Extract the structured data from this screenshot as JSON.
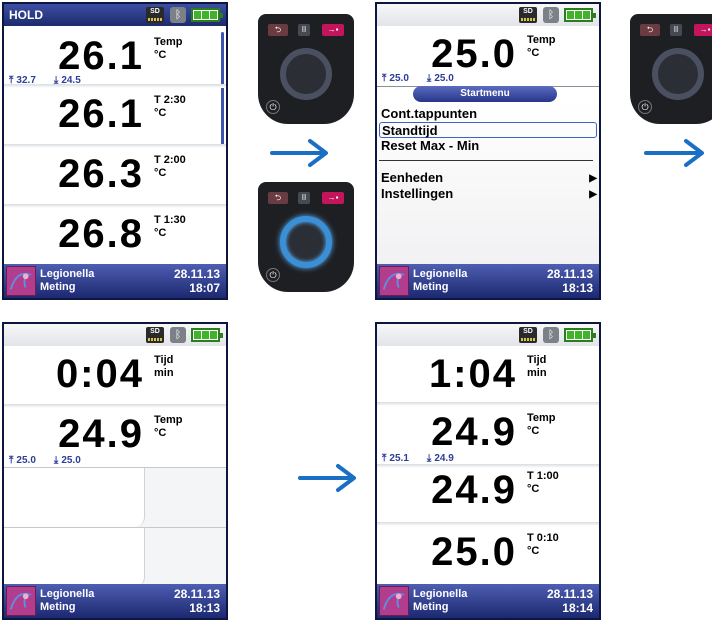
{
  "status": {
    "sd_label": "SD"
  },
  "screens": {
    "a": {
      "header": "HOLD",
      "rows": [
        {
          "value": "26.1",
          "label1": "Temp",
          "label2": "°C"
        },
        {
          "value": "26.1",
          "label1": "T 2:30",
          "label2": "°C"
        },
        {
          "value": "26.3",
          "label1": "T 2:00",
          "label2": "°C"
        },
        {
          "value": "26.8",
          "label1": "T 1:30",
          "label2": "°C"
        }
      ],
      "max": "32.7",
      "min": "24.5",
      "footer": {
        "line1": "Legionella",
        "line2": "Meting",
        "date": "28.11.13",
        "time": "18:07"
      }
    },
    "b": {
      "value": "25.0",
      "label1": "Temp",
      "label2": "°C",
      "max": "25.0",
      "min": "25.0",
      "menu_title": "Startmenu",
      "menu": [
        "Cont.tappunten",
        "Standtijd",
        "Reset Max - Min",
        "Eenheden",
        "Instellingen"
      ],
      "footer": {
        "line1": "Legionella",
        "line2": "Meting",
        "date": "28.11.13",
        "time": "18:13"
      }
    },
    "c": {
      "rows": [
        {
          "value": "0:04",
          "label1": "Tijd",
          "label2": "min"
        },
        {
          "value": "24.9",
          "label1": "Temp",
          "label2": "°C"
        }
      ],
      "max": "25.0",
      "min": "25.0",
      "footer": {
        "line1": "Legionella",
        "line2": "Meting",
        "date": "28.11.13",
        "time": "18:13"
      }
    },
    "d": {
      "rows": [
        {
          "value": "1:04",
          "label1": "Tijd",
          "label2": "min"
        },
        {
          "value": "24.9",
          "label1": "Temp",
          "label2": "°C"
        },
        {
          "value": "24.9",
          "label1": "T 1:00",
          "label2": "°C"
        },
        {
          "value": "25.0",
          "label1": "T 0:10",
          "label2": "°C"
        }
      ],
      "max": "25.1",
      "min": "24.9",
      "footer": {
        "line1": "Legionella",
        "line2": "Meting",
        "date": "28.11.13",
        "time": "18:14"
      }
    }
  },
  "colors": {
    "accent": "#1a6fc4",
    "header": "#24307a",
    "enter_key": "#c2155c"
  }
}
